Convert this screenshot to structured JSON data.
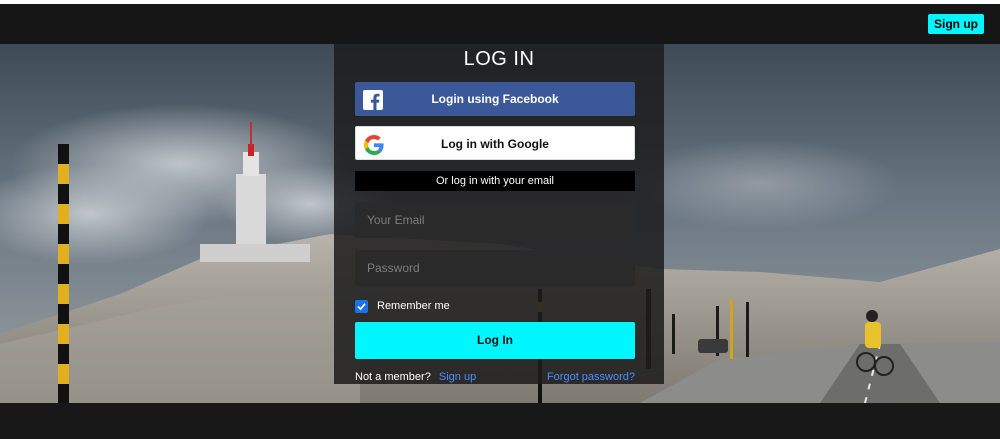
{
  "header": {
    "signup_label": "Sign up"
  },
  "login": {
    "title": "LOG IN",
    "facebook_label": "Login using Facebook",
    "google_label": "Log in with Google",
    "divider_text": "Or log in with your email",
    "email_placeholder": "Your Email",
    "password_placeholder": "Password",
    "remember_label": "Remember me",
    "remember_checked": true,
    "submit_label": "Log In",
    "not_member_text": "Not a member?",
    "signup_link": "Sign up",
    "forgot_link": "Forgot password?"
  },
  "colors": {
    "accent": "#00f7ff",
    "facebook": "#3b5998",
    "link": "#4c8dff",
    "checkbox": "#1a73e8",
    "topbar": "#161616"
  },
  "icons": {
    "facebook": "facebook-icon",
    "google": "google-icon",
    "checkmark": "checkmark-icon"
  }
}
